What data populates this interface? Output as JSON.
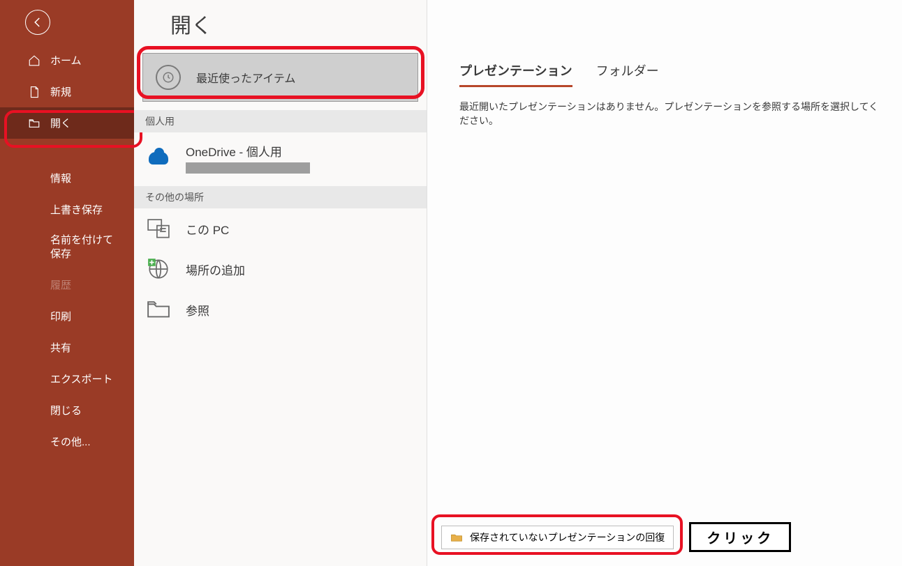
{
  "page_title": "開く",
  "sidebar": {
    "home": "ホーム",
    "new": "新規",
    "open": "開く",
    "info": "情報",
    "save": "上書き保存",
    "saveas": "名前を付けて保存",
    "history": "履歴",
    "print": "印刷",
    "share": "共有",
    "export": "エクスポート",
    "close": "閉じる",
    "more": "その他..."
  },
  "mid": {
    "recent": "最近使ったアイテム",
    "section_personal": "個人用",
    "onedrive": "OneDrive - 個人用",
    "section_other": "その他の場所",
    "thispc": "この PC",
    "addplace": "場所の追加",
    "browse": "参照"
  },
  "right": {
    "tab_presentations": "プレゼンテーション",
    "tab_folders": "フォルダー",
    "message": "最近開いたプレゼンテーションはありません。プレゼンテーションを参照する場所を選択してください。"
  },
  "recover": {
    "button": "保存されていないプレゼンテーションの回復",
    "click_label": "クリック"
  }
}
